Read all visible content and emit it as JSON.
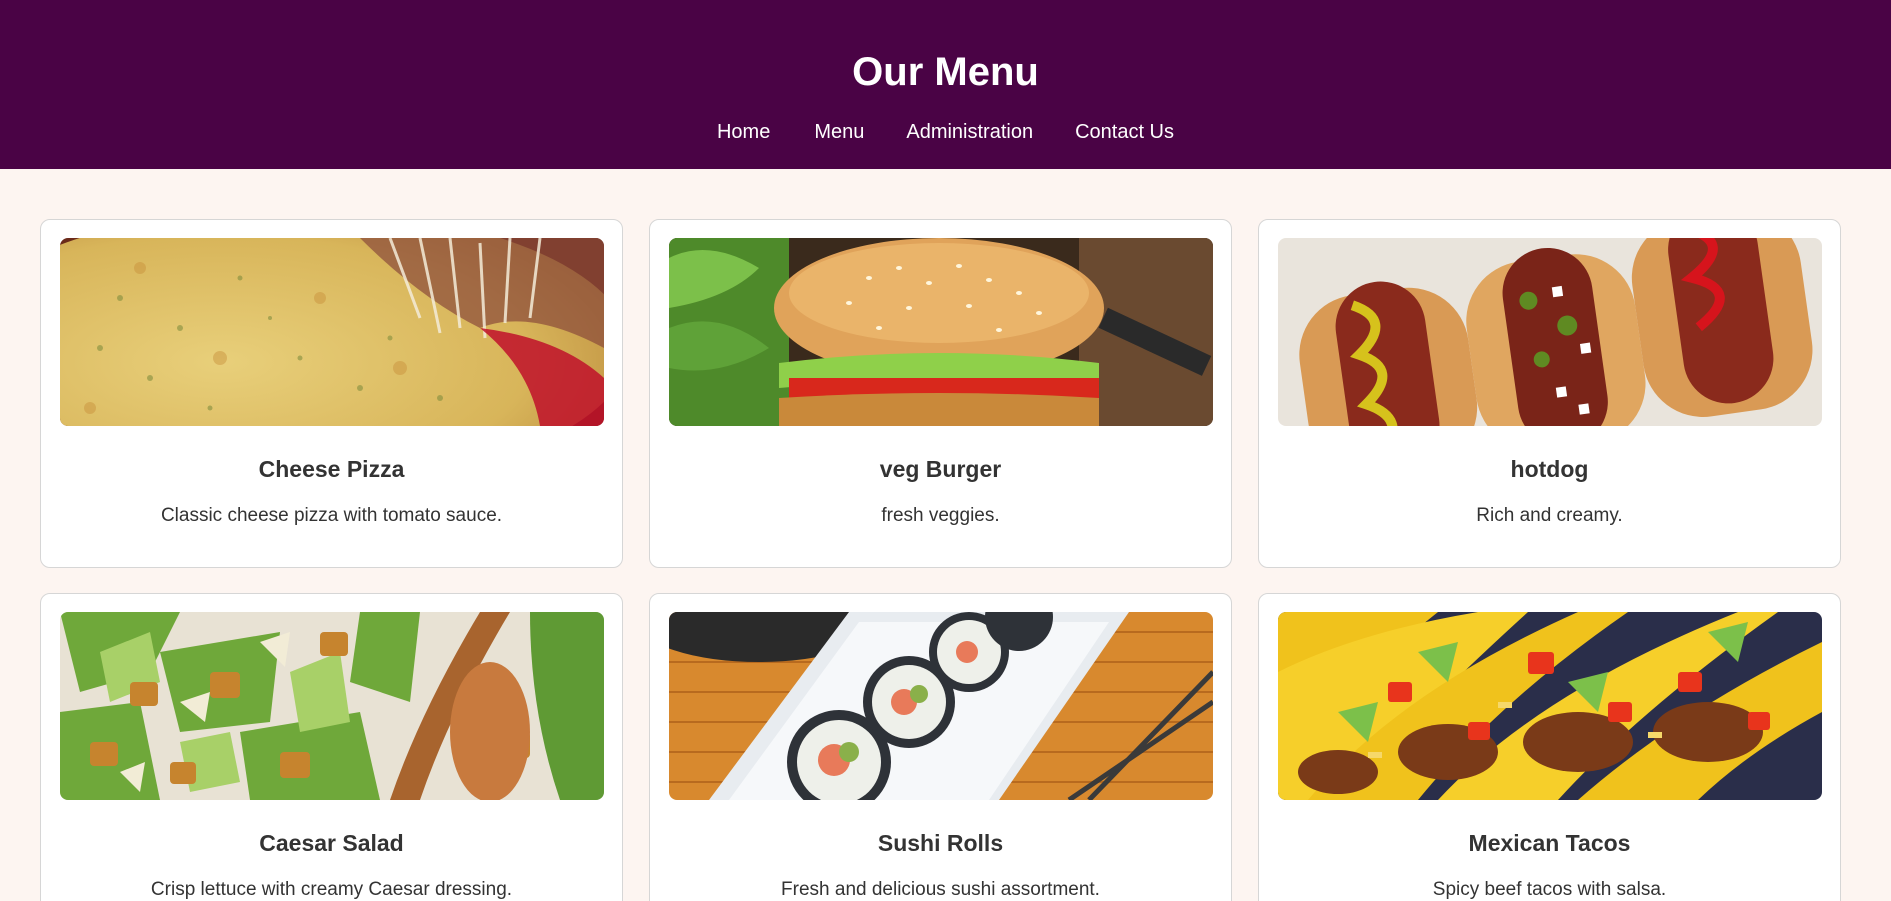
{
  "header": {
    "title": "Our Menu",
    "nav": [
      "Home",
      "Menu",
      "Administration",
      "Contact Us"
    ]
  },
  "menu_items": [
    {
      "name": "Cheese Pizza",
      "description": "Classic cheese pizza with tomato sauce.",
      "image": "cheese-pizza-photo"
    },
    {
      "name": "veg Burger",
      "description": "fresh veggies.",
      "image": "veg-burger-photo"
    },
    {
      "name": "hotdog",
      "description": "Rich and creamy.",
      "image": "hotdog-photo"
    },
    {
      "name": "Caesar Salad",
      "description": "Crisp lettuce with creamy Caesar dressing.",
      "image": "caesar-salad-photo"
    },
    {
      "name": "Sushi Rolls",
      "description": "Fresh and delicious sushi assortment.",
      "image": "sushi-rolls-photo"
    },
    {
      "name": "Mexican Tacos",
      "description": "Spicy beef tacos with salsa.",
      "image": "mexican-tacos-photo"
    }
  ],
  "colors": {
    "header_bg": "#4a0345",
    "page_bg": "#fdf5f1",
    "card_border": "#d6d6d6",
    "text": "#333333"
  }
}
